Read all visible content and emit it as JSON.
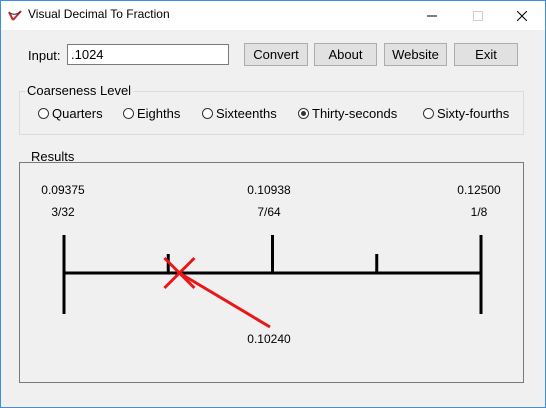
{
  "window": {
    "title": "Visual Decimal To Fraction"
  },
  "form": {
    "input_label": "Input:",
    "input_value": ".1024",
    "buttons": {
      "convert": "Convert",
      "about": "About",
      "website": "Website",
      "exit": "Exit"
    }
  },
  "coarseness": {
    "title": "Coarseness Level",
    "options": [
      "Quarters",
      "Eighths",
      "Sixteenths",
      "Thirty-seconds",
      "Sixty-fourths"
    ],
    "selected": "Thirty-seconds"
  },
  "results": {
    "title": "Results",
    "left": {
      "decimal": "0.09375",
      "fraction": "3/32"
    },
    "middle": {
      "decimal": "0.10938",
      "fraction": "7/64"
    },
    "right": {
      "decimal": "0.12500",
      "fraction": "1/8"
    },
    "input_marker": {
      "value": 0.1024,
      "label": "0.10240"
    },
    "range": [
      0.09375,
      0.125
    ],
    "ticks": [
      0.09375,
      0.1015625,
      0.109375,
      0.1171875,
      0.125
    ],
    "marker_color": "#e81818"
  }
}
